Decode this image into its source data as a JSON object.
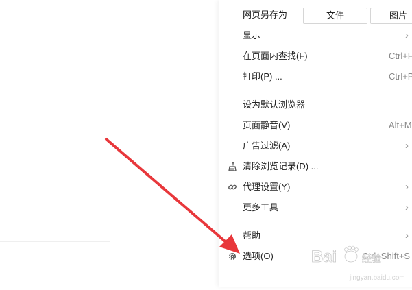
{
  "menu": {
    "save_as": {
      "label": "网页另存为",
      "btn_file": "文件",
      "btn_image": "图片"
    },
    "items": [
      {
        "label": "显示",
        "shortcut": "",
        "submenu": true
      },
      {
        "label": "在页面内查找(F)",
        "shortcut": "Ctrl+F",
        "submenu": false
      },
      {
        "label": "打印(P) ...",
        "shortcut": "Ctrl+P",
        "submenu": false
      },
      {
        "label": "设为默认浏览器",
        "shortcut": "",
        "submenu": false
      },
      {
        "label": "页面静音(V)",
        "shortcut": "Alt+M",
        "submenu": false
      },
      {
        "label": "广告过滤(A)",
        "shortcut": "",
        "submenu": true
      },
      {
        "label": "清除浏览记录(D) ...",
        "shortcut": "",
        "submenu": false,
        "icon": "broom-icon"
      },
      {
        "label": "代理设置(Y)",
        "shortcut": "",
        "submenu": true,
        "icon": "link-icon"
      },
      {
        "label": "更多工具",
        "shortcut": "",
        "submenu": true
      },
      {
        "label": "帮助",
        "shortcut": "",
        "submenu": true
      },
      {
        "label": "选项(O)",
        "shortcut": "Ctrl+Shift+S",
        "submenu": false,
        "icon": "gear-icon"
      }
    ]
  },
  "annotation": {
    "arrow_color": "#e8373b"
  },
  "watermark": {
    "brand": "Baidu",
    "sub": "经验",
    "url": "jingyan.baidu.com"
  }
}
